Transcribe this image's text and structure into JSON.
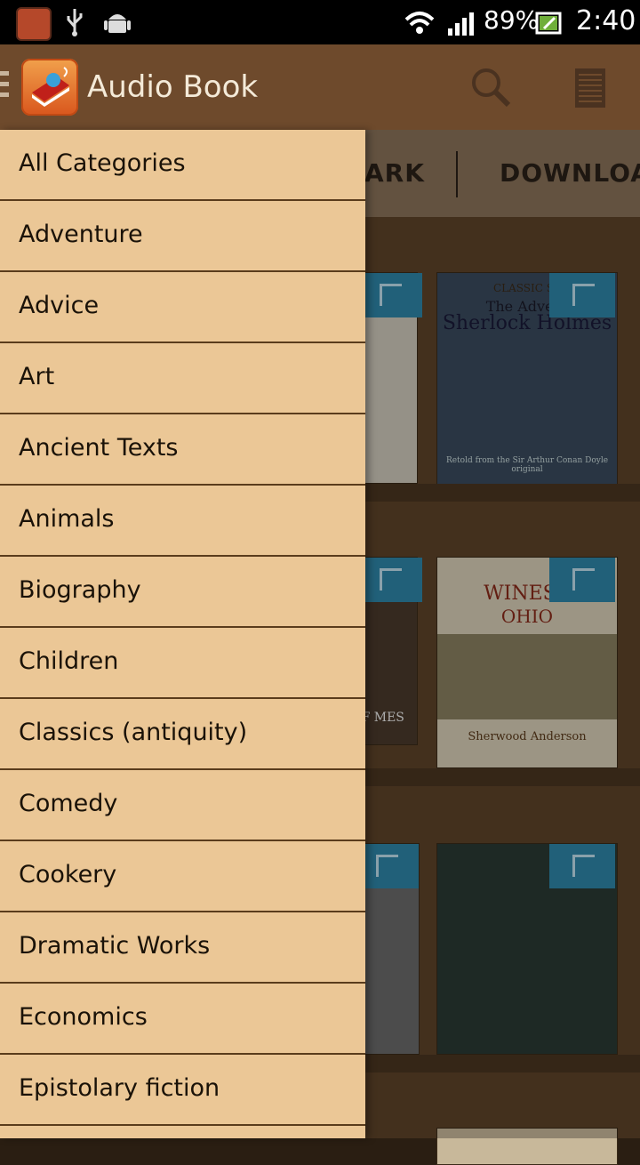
{
  "status_bar": {
    "battery_percent": "89%",
    "time": "2:40",
    "icons": [
      "app-notification-icon",
      "usb-icon",
      "android-debug-icon",
      "wifi-icon",
      "signal-icon",
      "battery-charging-icon"
    ]
  },
  "app_bar": {
    "title": "Audio Book",
    "icons": [
      "hamburger-menu-icon",
      "app-logo-icon",
      "search-icon",
      "list-view-icon"
    ]
  },
  "tabs": {
    "partial_left": "ARK",
    "download": "DOWNLOAD"
  },
  "books": [
    {
      "title_top": "CLASSIC ST",
      "title_main": "The Advent",
      "title_sub": "Sherlock Holmes",
      "footer": "Retold from the Sir Arthur Conan Doyle original"
    },
    {
      "title_main": "WINESB",
      "title_sub": "OHIO",
      "footer": "Sherwood Anderson"
    },
    {
      "partial_left_text": "OF MES"
    }
  ],
  "drawer": {
    "items": [
      "All Categories",
      "Adventure",
      "Advice",
      "Art",
      "Ancient Texts",
      "Animals",
      "Biography",
      "Children",
      "Classics (antiquity)",
      "Comedy",
      "Cookery",
      "Dramatic Works",
      "Economics",
      "Epistolary fiction"
    ]
  },
  "colors": {
    "status_bar": "#000000",
    "app_bar": "#6e4a2c",
    "drawer_bg": "#ebc796",
    "drawer_divider": "#5a3c1c",
    "flag": "#2f86a8"
  }
}
